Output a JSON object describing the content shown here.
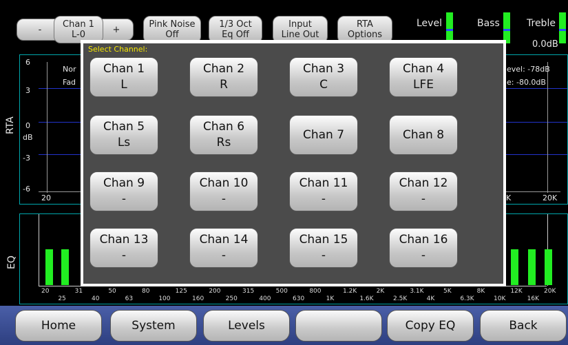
{
  "toolbar": {
    "minus_label": "-",
    "channel_line1": "Chan 1",
    "channel_line2": "L-0",
    "plus_label": "+",
    "pink_noise_line1": "Pink Noise",
    "pink_noise_line2": "Off",
    "oct_eq_line1": "1/3 Oct",
    "oct_eq_line2": "Eq Off",
    "input_line1": "Input",
    "input_line2": "Line Out",
    "rta_options_line1": "RTA",
    "rta_options_line2": "Options"
  },
  "meters": {
    "level_label": "Level",
    "bass_label": "Bass",
    "treble_label": "Treble",
    "treble_value": "0.0dB"
  },
  "rta": {
    "side_label": "RTA",
    "y_ticks": [
      "6",
      "3",
      "0",
      "dB",
      "-3",
      "-6"
    ],
    "x_start": "20",
    "x_end": "20K",
    "x_end_left": "K",
    "left_text_1": "Nor",
    "left_text_2": "Fad",
    "right_text_1": "evel: -78dB",
    "right_text_2": "e: -80.0dB"
  },
  "eq": {
    "side_label": "EQ",
    "freq_top": [
      "20",
      "31",
      "50",
      "80",
      "125",
      "200",
      "315",
      "500",
      "800",
      "1.2K",
      "2K",
      "3.1K",
      "5K",
      "8K",
      "12K",
      "20K"
    ],
    "freq_bottom": [
      "25",
      "40",
      "63",
      "100",
      "160",
      "250",
      "400",
      "630",
      "1K",
      "1.6K",
      "2.5K",
      "4K",
      "6.3K",
      "10K",
      "16K"
    ]
  },
  "dialog": {
    "title": "Select Channel:",
    "channels": [
      {
        "name": "Chan 1",
        "sub": "L"
      },
      {
        "name": "Chan 2",
        "sub": "R"
      },
      {
        "name": "Chan 3",
        "sub": "C"
      },
      {
        "name": "Chan 4",
        "sub": "LFE"
      },
      {
        "name": "Chan 5",
        "sub": "Ls"
      },
      {
        "name": "Chan 6",
        "sub": "Rs"
      },
      {
        "name": "Chan 7",
        "sub": ""
      },
      {
        "name": "Chan 8",
        "sub": ""
      },
      {
        "name": "Chan 9",
        "sub": "-"
      },
      {
        "name": "Chan 10",
        "sub": "-"
      },
      {
        "name": "Chan 11",
        "sub": "-"
      },
      {
        "name": "Chan 12",
        "sub": "-"
      },
      {
        "name": "Chan 13",
        "sub": "-"
      },
      {
        "name": "Chan 14",
        "sub": "-"
      },
      {
        "name": "Chan 15",
        "sub": "-"
      },
      {
        "name": "Chan 16",
        "sub": "-"
      }
    ]
  },
  "nav": {
    "home": "Home",
    "system": "System",
    "levels": "Levels",
    "blank": "",
    "copy_eq": "Copy EQ",
    "back": "Back"
  },
  "colors": {
    "accent_green": "#22ee22",
    "meter_marker": "#2a4cff",
    "panel_border": "#00a7ad",
    "dialog_title": "#f5e600",
    "nav_background": "#3a4d96"
  }
}
